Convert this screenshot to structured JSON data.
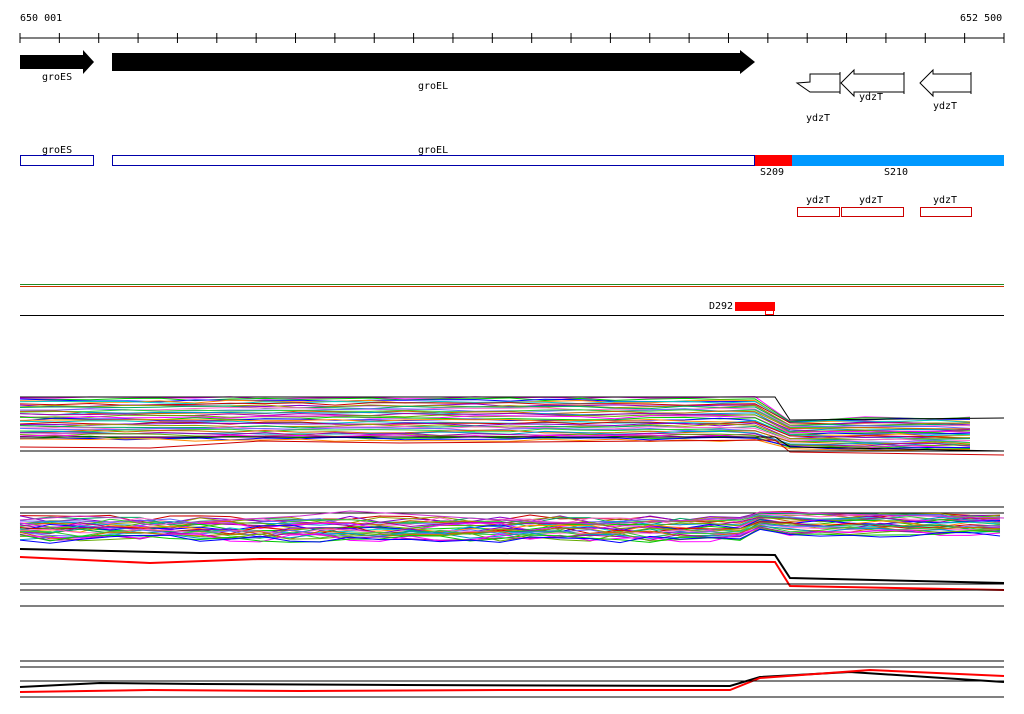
{
  "ruler": {
    "start": "650 001",
    "end": "652 500"
  },
  "genes": [
    {
      "name": "groES",
      "strand": "+"
    },
    {
      "name": "groEL",
      "strand": "+"
    },
    {
      "name": "ydzT",
      "strand": "-"
    },
    {
      "name": "ydzT",
      "strand": "-"
    },
    {
      "name": "ydzT",
      "strand": "-"
    }
  ],
  "features": [
    {
      "name": "groES",
      "color": "#0000aa"
    },
    {
      "name": "groEL",
      "color": "#0000aa"
    },
    {
      "name": "S209",
      "color": "#ff0000"
    },
    {
      "name": "S210",
      "color": "#0099ff"
    }
  ],
  "ydzt_boxes": [
    {
      "name": "ydzT",
      "color": "#cc0000"
    },
    {
      "name": "ydzT",
      "color": "#cc0000"
    },
    {
      "name": "ydzT",
      "color": "#cc0000"
    }
  ],
  "marker": {
    "name": "D292",
    "color": "#ff0000"
  }
}
